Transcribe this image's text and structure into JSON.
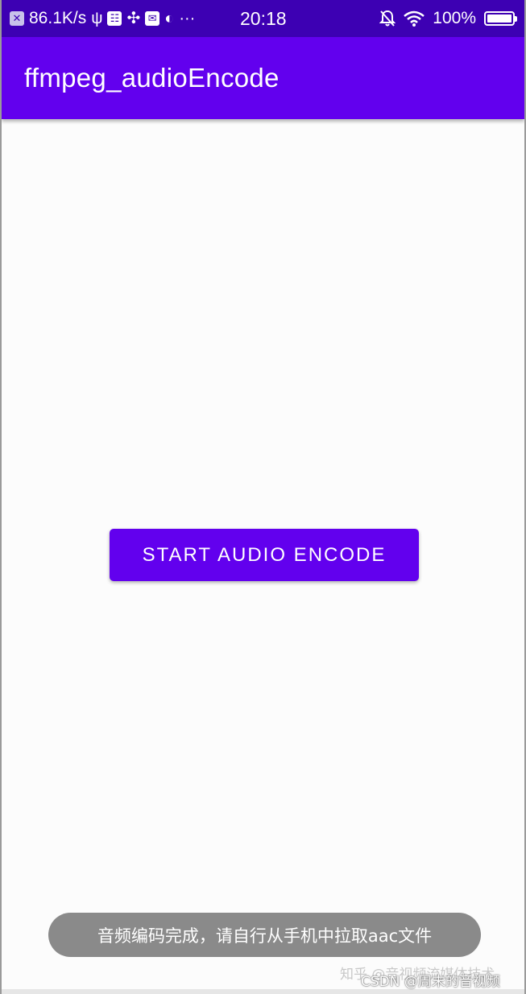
{
  "status_bar": {
    "net_speed": "86.1K/s",
    "time": "20:18",
    "battery": "100%",
    "battery_level": 1.0,
    "icons": [
      "close-box-icon",
      "usb-icon",
      "app-icon",
      "fan-icon",
      "mail-icon",
      "browser-icon",
      "more-icon",
      "mute-icon",
      "wifi-icon",
      "battery-icon"
    ],
    "more": "···"
  },
  "app_bar": {
    "title": "ffmpeg_audioEncode",
    "color": "#6200ee"
  },
  "main": {
    "button_label": "START AUDIO ENCODE"
  },
  "toast": {
    "message": "音频编码完成，请自行从手机中拉取aac文件"
  },
  "watermark": {
    "zhihu": "知乎 @音视频流媒体技术",
    "csdn": "CSDN @周末的音视频"
  }
}
